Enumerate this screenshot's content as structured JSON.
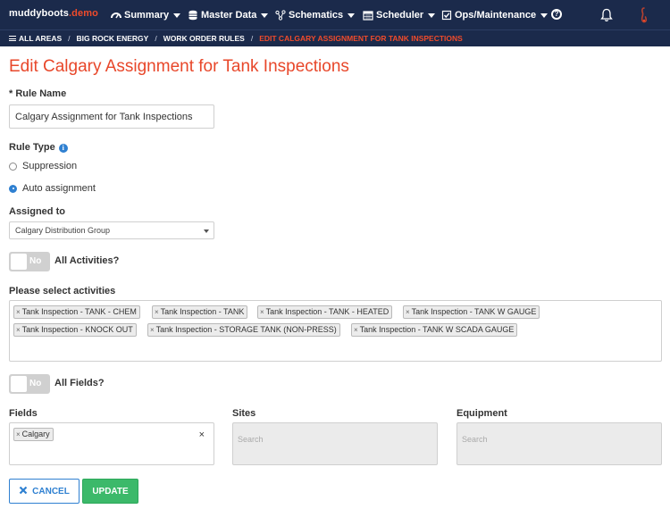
{
  "brand": {
    "name": "muddyboots",
    "suffix": ".demo"
  },
  "nav": {
    "items": [
      {
        "label": "Summary",
        "icon": "tachometer-icon"
      },
      {
        "label": "Master Data",
        "icon": "database-icon"
      },
      {
        "label": "Schematics",
        "icon": "sitemap-icon"
      },
      {
        "label": "Scheduler",
        "icon": "calendar-icon"
      },
      {
        "label": "Ops/Maintenance",
        "icon": "checkbox-icon"
      }
    ],
    "help_icon": "question-circle-icon",
    "help_glyph": "?",
    "bell_icon": "bell-icon",
    "user_icon": "user-icon"
  },
  "breadcrumb": {
    "items": [
      "ALL AREAS",
      "BIG ROCK ENERGY",
      "WORK ORDER RULES",
      "EDIT CALGARY ASSIGNMENT FOR TANK INSPECTIONS"
    ],
    "separator": "/"
  },
  "page": {
    "title": "Edit Calgary Assignment for Tank Inspections"
  },
  "form": {
    "rule_name": {
      "label": "* Rule Name",
      "value": "Calgary Assignment for Tank Inspections"
    },
    "rule_type": {
      "label": "Rule Type",
      "info_glyph": "i",
      "options": [
        {
          "label": "Suppression",
          "selected": false
        },
        {
          "label": "Auto assignment",
          "selected": true
        }
      ]
    },
    "assigned_to": {
      "label": "Assigned to",
      "value": "Calgary Distribution Group"
    },
    "all_activities": {
      "label": "All Activities?",
      "toggle_text": "No"
    },
    "activities": {
      "label": "Please select activities",
      "remove_glyph": "×",
      "tags": [
        "Tank Inspection - TANK - CHEM",
        "Tank Inspection - TANK",
        "Tank Inspection - TANK - HEATED",
        "Tank Inspection - TANK W GAUGE",
        "Tank Inspection - KNOCK OUT",
        "Tank Inspection - STORAGE TANK (NON-PRESS)",
        "Tank Inspection - TANK W SCADA GAUGE"
      ]
    },
    "all_fields": {
      "label": "All Fields?",
      "toggle_text": "No"
    },
    "fields": {
      "label": "Fields",
      "tags": [
        "Calgary"
      ],
      "clear_glyph": "×"
    },
    "sites": {
      "label": "Sites",
      "placeholder": "Search"
    },
    "equipment": {
      "label": "Equipment",
      "placeholder": "Search"
    }
  },
  "actions": {
    "cancel": {
      "label": "CANCEL",
      "icon": "close-icon"
    },
    "update": {
      "label": "UPDATE"
    }
  },
  "colors": {
    "navbar": "#1b2a4b",
    "accent_red": "#e8472a",
    "primary_blue": "#2f80d1",
    "success_green": "#3cb96a"
  }
}
